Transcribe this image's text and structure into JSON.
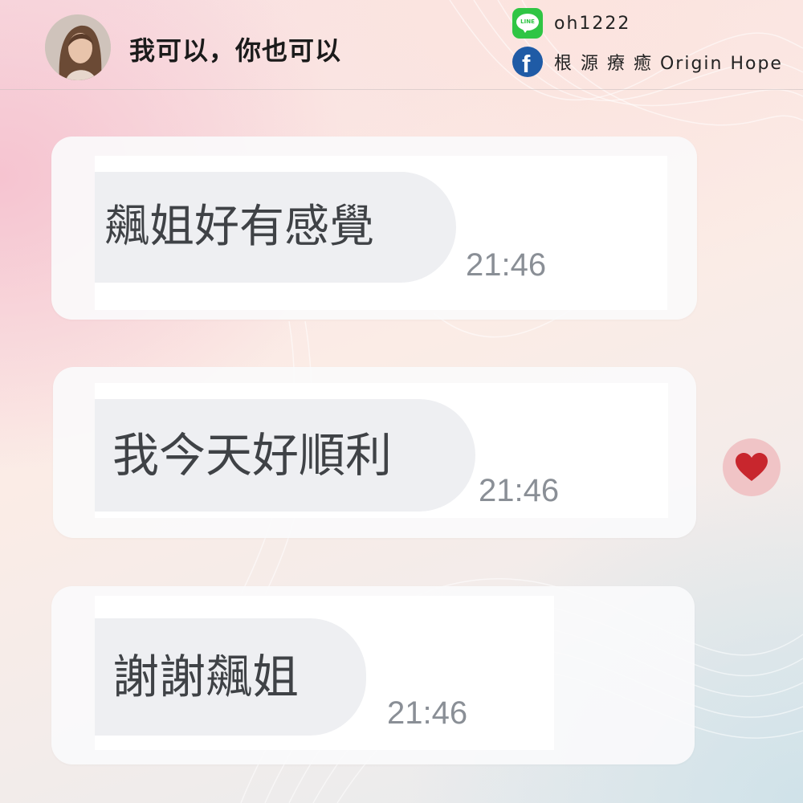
{
  "header": {
    "title": "我可以，你也可以",
    "contacts": [
      {
        "icon": "line-icon",
        "label": "oh1222",
        "icon_text": "LINE",
        "color": "#2fc544"
      },
      {
        "icon": "facebook-icon",
        "label": "根 源 療 癒 Origin Hope",
        "icon_text": "f",
        "color": "#1f5ba6"
      }
    ]
  },
  "messages": [
    {
      "text": "飆姐好有感覺",
      "time": "21:46"
    },
    {
      "text": "我今天好順利",
      "time": "21:46"
    },
    {
      "text": "謝謝飆姐",
      "time": "21:46"
    }
  ],
  "reaction": {
    "icon": "heart-icon",
    "color": "#c8262d",
    "background": "#f0c4c6"
  }
}
